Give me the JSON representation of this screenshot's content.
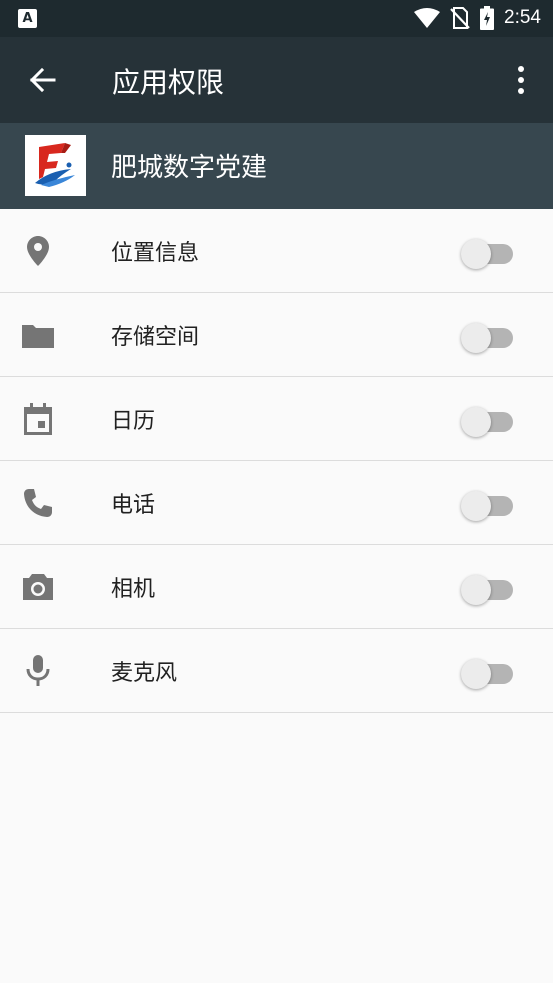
{
  "status_bar": {
    "time": "2:54",
    "notification_icon_letter": "A"
  },
  "app_bar": {
    "title": "应用权限"
  },
  "app_header": {
    "name": "肥城数字党建"
  },
  "permissions": [
    {
      "label": "位置信息",
      "icon": "location-icon",
      "enabled": false
    },
    {
      "label": "存储空间",
      "icon": "folder-icon",
      "enabled": false
    },
    {
      "label": "日历",
      "icon": "calendar-icon",
      "enabled": false
    },
    {
      "label": "电话",
      "icon": "phone-icon",
      "enabled": false
    },
    {
      "label": "相机",
      "icon": "camera-icon",
      "enabled": false
    },
    {
      "label": "麦克风",
      "icon": "microphone-icon",
      "enabled": false
    }
  ],
  "colors": {
    "status_bar": "#1e2a2f",
    "app_bar": "#263238",
    "app_header": "#37474f",
    "icon_gray": "#757575",
    "toggle_off_track": "#b4b4b4",
    "toggle_off_thumb": "#ececec"
  }
}
